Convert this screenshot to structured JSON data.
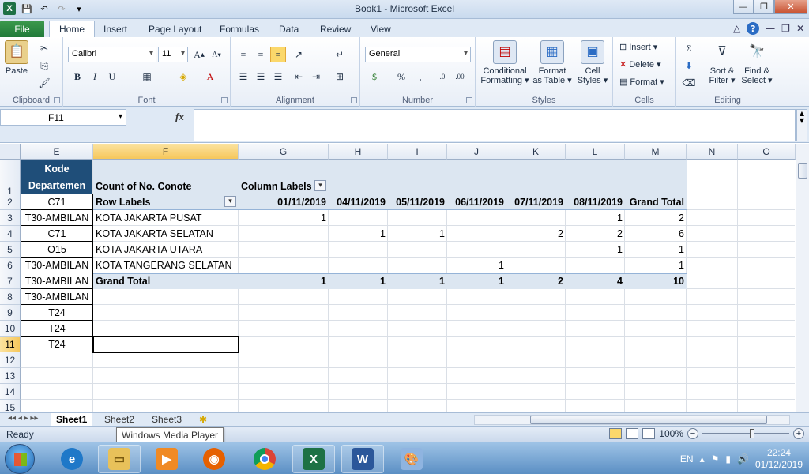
{
  "window": {
    "title": "Book1 - Microsoft Excel"
  },
  "tabs": [
    "File",
    "Home",
    "Insert",
    "Page Layout",
    "Formulas",
    "Data",
    "Review",
    "View"
  ],
  "ribbon": {
    "clipboard": {
      "paste": "Paste",
      "label": "Clipboard"
    },
    "font": {
      "name": "Calibri",
      "size": "11",
      "label": "Font"
    },
    "alignment": {
      "label": "Alignment"
    },
    "number": {
      "format": "General",
      "label": "Number"
    },
    "styles": {
      "conditional": "Conditional\nFormatting ▾",
      "format_table": "Format\nas Table ▾",
      "cell_styles": "Cell\nStyles ▾",
      "label": "Styles"
    },
    "cells": {
      "insert": "Insert ▾",
      "delete": "Delete ▾",
      "format": "Format ▾",
      "label": "Cells"
    },
    "editing": {
      "sort": "Sort &\nFilter ▾",
      "find": "Find &\nSelect ▾",
      "label": "Editing"
    }
  },
  "formula_bar": {
    "name_box": "F11",
    "fx": "fx",
    "value": ""
  },
  "columns": [
    "E",
    "F",
    "G",
    "H",
    "I",
    "J",
    "K",
    "L",
    "M",
    "N",
    "O"
  ],
  "rows": [
    "1",
    "2",
    "3",
    "4",
    "5",
    "6",
    "7",
    "8",
    "9",
    "10",
    "11",
    "12",
    "13",
    "14",
    "15"
  ],
  "dept": {
    "header_line1": "Kode",
    "header_line2": "Departemen",
    "values": [
      "C71",
      "T30-AMBILAN",
      "C71",
      "O15",
      "T30-AMBILAN",
      "T30-AMBILAN",
      "T30-AMBILAN",
      "T24",
      "T24",
      "T24"
    ]
  },
  "pivot": {
    "count_label": "Count of No. Conote",
    "column_labels": "Column Labels",
    "row_labels": "Row Labels",
    "dates": [
      "01/11/2019",
      "04/11/2019",
      "05/11/2019",
      "06/11/2019",
      "07/11/2019",
      "08/11/2019"
    ],
    "grand_total_header": "Grand Total",
    "rows": [
      {
        "label": "KOTA JAKARTA PUSAT",
        "values": [
          "1",
          "",
          "",
          "",
          "",
          "1"
        ],
        "total": "2"
      },
      {
        "label": "KOTA JAKARTA SELATAN",
        "values": [
          "",
          "1",
          "1",
          "",
          "2",
          "2"
        ],
        "total": "6"
      },
      {
        "label": "KOTA JAKARTA UTARA",
        "values": [
          "",
          "",
          "",
          "",
          "",
          "1"
        ],
        "total": "1"
      },
      {
        "label": "KOTA TANGERANG SELATAN",
        "values": [
          "",
          "",
          "",
          "1",
          "",
          ""
        ],
        "total": "1"
      }
    ],
    "grand_total_label": "Grand Total",
    "grand_totals": [
      "1",
      "1",
      "1",
      "1",
      "2",
      "4"
    ],
    "grand_total_all": "10"
  },
  "sheets": [
    "Sheet1",
    "Sheet2",
    "Sheet3"
  ],
  "status": {
    "ready": "Ready",
    "tooltip": "Windows Media Player",
    "zoom": "100%"
  },
  "taskbar": {
    "lang": "EN",
    "time": "22:24",
    "date": "01/12/2019"
  }
}
